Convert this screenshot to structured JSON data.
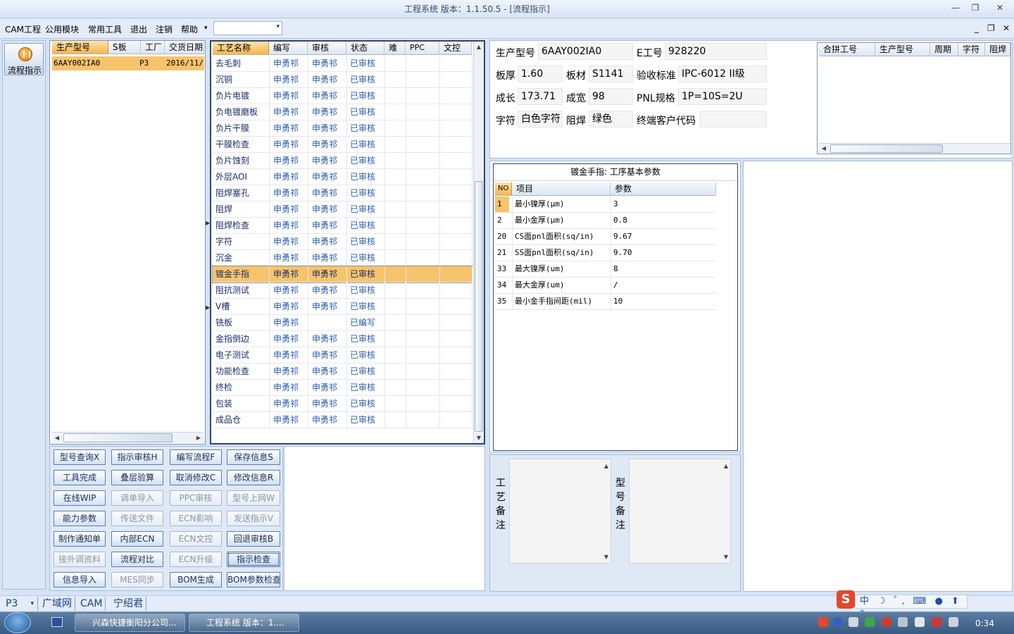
{
  "window": {
    "title": "工程系统   版本：1.1.50.5 - [流程指示]"
  },
  "menu": {
    "items": [
      "CAM工程",
      "公用模块",
      "常用工具",
      "退出",
      "注销",
      "帮助"
    ],
    "combo_value": ""
  },
  "nav": {
    "button_label": "流程指示"
  },
  "models": {
    "headers": [
      "生产型号",
      "S板",
      "工厂",
      "交货日期"
    ],
    "rows": [
      {
        "model": "6AAY002IA0",
        "s": "",
        "factory": "P3",
        "date": "2016/11/"
      }
    ]
  },
  "process": {
    "headers": [
      "工艺名称",
      "编写",
      "审核",
      "状态",
      "难",
      "PPC",
      "文控"
    ],
    "selected_index": 13,
    "rows": [
      {
        "name": "去毛刺",
        "writer": "申勇祁",
        "reviewer": "申勇祁",
        "status": "已审核"
      },
      {
        "name": "沉铜",
        "writer": "申勇祁",
        "reviewer": "申勇祁",
        "status": "已审核"
      },
      {
        "name": "负片电镀",
        "writer": "申勇祁",
        "reviewer": "申勇祁",
        "status": "已审核"
      },
      {
        "name": "负电镀磨板",
        "writer": "申勇祁",
        "reviewer": "申勇祁",
        "status": "已审核"
      },
      {
        "name": "负片干膜",
        "writer": "申勇祁",
        "reviewer": "申勇祁",
        "status": "已审核"
      },
      {
        "name": "干膜检查",
        "writer": "申勇祁",
        "reviewer": "申勇祁",
        "status": "已审核"
      },
      {
        "name": "负片蚀刻",
        "writer": "申勇祁",
        "reviewer": "申勇祁",
        "status": "已审核"
      },
      {
        "name": "外层AOI",
        "writer": "申勇祁",
        "reviewer": "申勇祁",
        "status": "已审核"
      },
      {
        "name": "阻焊塞孔",
        "writer": "申勇祁",
        "reviewer": "申勇祁",
        "status": "已审核"
      },
      {
        "name": "阻焊",
        "writer": "申勇祁",
        "reviewer": "申勇祁",
        "status": "已审核"
      },
      {
        "name": "阻焊检查",
        "writer": "申勇祁",
        "reviewer": "申勇祁",
        "status": "已审核"
      },
      {
        "name": "字符",
        "writer": "申勇祁",
        "reviewer": "申勇祁",
        "status": "已审核"
      },
      {
        "name": "沉金",
        "writer": "申勇祁",
        "reviewer": "申勇祁",
        "status": "已审核"
      },
      {
        "name": "镀金手指",
        "writer": "申勇祁",
        "reviewer": "申勇祁",
        "status": "已审核"
      },
      {
        "name": "阻抗测试",
        "writer": "申勇祁",
        "reviewer": "申勇祁",
        "status": "已审核"
      },
      {
        "name": "V槽",
        "writer": "申勇祁",
        "reviewer": "申勇祁",
        "status": "已审核"
      },
      {
        "name": "铣板",
        "writer": "申勇祁",
        "reviewer": "",
        "status": "已编写"
      },
      {
        "name": "金指倒边",
        "writer": "申勇祁",
        "reviewer": "申勇祁",
        "status": "已审核"
      },
      {
        "name": "电子测试",
        "writer": "申勇祁",
        "reviewer": "申勇祁",
        "status": "已审核"
      },
      {
        "name": "功能检查",
        "writer": "申勇祁",
        "reviewer": "申勇祁",
        "status": "已审核"
      },
      {
        "name": "终检",
        "writer": "申勇祁",
        "reviewer": "申勇祁",
        "status": "已审核"
      },
      {
        "name": "包装",
        "writer": "申勇祁",
        "reviewer": "申勇祁",
        "status": "已审核"
      },
      {
        "name": "成品仓",
        "writer": "申勇祁",
        "reviewer": "申勇祁",
        "status": "已审核"
      }
    ]
  },
  "actions": {
    "rows": [
      [
        {
          "label": "型号查询X",
          "enabled": true
        },
        {
          "label": "指示审核H",
          "enabled": true
        },
        {
          "label": "编写流程F",
          "enabled": true
        },
        {
          "label": "保存信息S",
          "enabled": true
        }
      ],
      [
        {
          "label": "工具完成",
          "enabled": true
        },
        {
          "label": "叠层验算",
          "enabled": true
        },
        {
          "label": "取消修改C",
          "enabled": true
        },
        {
          "label": "修改信息R",
          "enabled": true
        }
      ],
      [
        {
          "label": "在线WIP",
          "enabled": true
        },
        {
          "label": "调单导入",
          "enabled": false
        },
        {
          "label": "PPC审核",
          "enabled": false
        },
        {
          "label": "型号上网W",
          "enabled": false
        }
      ],
      [
        {
          "label": "能力参数",
          "enabled": true
        },
        {
          "label": "传送文件",
          "enabled": false
        },
        {
          "label": "ECN影响",
          "enabled": false
        },
        {
          "label": "发送指示V",
          "enabled": false
        }
      ],
      [
        {
          "label": "制作通知单",
          "enabled": true
        },
        {
          "label": "内部ECN",
          "enabled": true
        },
        {
          "label": "ECN文控",
          "enabled": false
        },
        {
          "label": "回退审核B",
          "enabled": true
        }
      ],
      [
        {
          "label": "接外调资料",
          "enabled": false
        },
        {
          "label": "流程对比",
          "enabled": true
        },
        {
          "label": "ECN升级",
          "enabled": false
        },
        {
          "label": "指示检查",
          "enabled": true,
          "focused": true
        }
      ],
      [
        {
          "label": "信息导入",
          "enabled": true
        },
        {
          "label": "MES同步",
          "enabled": false
        },
        {
          "label": "BOM生成",
          "enabled": true
        },
        {
          "label": "BOM参数检查",
          "enabled": true
        }
      ]
    ]
  },
  "info": {
    "model_label": "生产型号",
    "model": "6AAY002IA0",
    "eno_label": "E工号",
    "eno": "928220",
    "thickness_label": "板厚",
    "thickness": "1.60",
    "material_label": "板材",
    "material": "S1141",
    "standard_label": "验收标准",
    "standard": "IPC-6012 II级",
    "length_label": "成长",
    "length": "173.71",
    "width_label": "成宽",
    "width": "98",
    "pnl_label": "PNL规格",
    "pnl": "1P=10S=2U",
    "char_label": "字符",
    "char": "白色字符",
    "mask_label": "阻焊",
    "mask": "绿色",
    "customer_label": "终端客户代码",
    "customer": ""
  },
  "merge": {
    "headers": [
      "合拼工号",
      "生产型号",
      "周期",
      "字符",
      "阻焊"
    ]
  },
  "params": {
    "title": "镀金手指: 工序基本参数",
    "headers": [
      "NO",
      "项目",
      "参数"
    ],
    "rows": [
      {
        "no": "1",
        "item": "最小镍厚(μm)",
        "value": "3"
      },
      {
        "no": "2",
        "item": "最小金厚(μm)",
        "value": "0.8"
      },
      {
        "no": "20",
        "item": "CS面pnl面积(sq/in)",
        "value": "9.67"
      },
      {
        "no": "21",
        "item": "SS面pnl面积(sq/in)",
        "value": "9.70"
      },
      {
        "no": "33",
        "item": "最大镍厚(um)",
        "value": "8"
      },
      {
        "no": "34",
        "item": "最大金厚(um)",
        "value": "/"
      },
      {
        "no": "35",
        "item": "最小金手指间距(mil)",
        "value": "10"
      }
    ]
  },
  "remarks": {
    "process_label": [
      "工",
      "艺",
      "备",
      "注"
    ],
    "model_label": [
      "型",
      "号",
      "备",
      "注"
    ]
  },
  "statusbar": {
    "items": [
      "P3",
      "广域网",
      "CAM",
      "宁绍君"
    ]
  },
  "taskbar": {
    "apps": [
      "兴森快捷衡阳分公司...",
      "工程系统   版本：1...."
    ],
    "clock": "0:34"
  },
  "colors": {
    "selection": "#f7c46c",
    "accent": "#2a5db0"
  }
}
